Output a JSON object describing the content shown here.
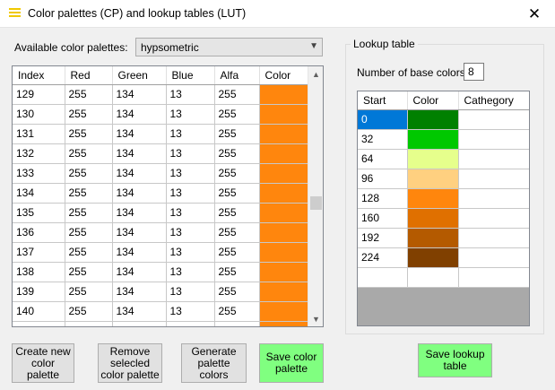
{
  "window": {
    "title": "Color palettes (CP) and lookup tables (LUT)",
    "close_glyph": "✕"
  },
  "palette_selector": {
    "label": "Available color palettes:",
    "value": "hypsometric"
  },
  "palette_table": {
    "columns": [
      "Index",
      "Red",
      "Green",
      "Blue",
      "Alfa",
      "Color"
    ],
    "rows": [
      {
        "index": "129",
        "red": "255",
        "green": "134",
        "blue": "13",
        "alfa": "255",
        "color": "#ff860d"
      },
      {
        "index": "130",
        "red": "255",
        "green": "134",
        "blue": "13",
        "alfa": "255",
        "color": "#ff860d"
      },
      {
        "index": "131",
        "red": "255",
        "green": "134",
        "blue": "13",
        "alfa": "255",
        "color": "#ff860d"
      },
      {
        "index": "132",
        "red": "255",
        "green": "134",
        "blue": "13",
        "alfa": "255",
        "color": "#ff860d"
      },
      {
        "index": "133",
        "red": "255",
        "green": "134",
        "blue": "13",
        "alfa": "255",
        "color": "#ff860d"
      },
      {
        "index": "134",
        "red": "255",
        "green": "134",
        "blue": "13",
        "alfa": "255",
        "color": "#ff860d"
      },
      {
        "index": "135",
        "red": "255",
        "green": "134",
        "blue": "13",
        "alfa": "255",
        "color": "#ff860d"
      },
      {
        "index": "136",
        "red": "255",
        "green": "134",
        "blue": "13",
        "alfa": "255",
        "color": "#ff860d"
      },
      {
        "index": "137",
        "red": "255",
        "green": "134",
        "blue": "13",
        "alfa": "255",
        "color": "#ff860d"
      },
      {
        "index": "138",
        "red": "255",
        "green": "134",
        "blue": "13",
        "alfa": "255",
        "color": "#ff860d"
      },
      {
        "index": "139",
        "red": "255",
        "green": "134",
        "blue": "13",
        "alfa": "255",
        "color": "#ff860d"
      },
      {
        "index": "140",
        "red": "255",
        "green": "134",
        "blue": "13",
        "alfa": "255",
        "color": "#ff860d"
      },
      {
        "index": "",
        "red": "",
        "green": "",
        "blue": "",
        "alfa": "",
        "color": "#ff860d"
      }
    ]
  },
  "lookup_table": {
    "group_title": "Lookup table",
    "base_colors_label": "Number of base colors:",
    "base_colors_value": "8",
    "columns": [
      "Start",
      "Color",
      "Cathegory"
    ],
    "rows": [
      {
        "start": "0",
        "color": "#008000",
        "category": ""
      },
      {
        "start": "32",
        "color": "#00c800",
        "category": ""
      },
      {
        "start": "64",
        "color": "#e6ff8c",
        "category": ""
      },
      {
        "start": "96",
        "color": "#ffd080",
        "category": ""
      },
      {
        "start": "128",
        "color": "#ff860d",
        "category": ""
      },
      {
        "start": "160",
        "color": "#e07000",
        "category": ""
      },
      {
        "start": "192",
        "color": "#b45a00",
        "category": ""
      },
      {
        "start": "224",
        "color": "#804000",
        "category": ""
      },
      {
        "start": "",
        "color": "",
        "category": ""
      }
    ]
  },
  "buttons": {
    "create": "Create new color palette",
    "remove": "Remove selecled color palette",
    "generate": "Generate palette colors",
    "save_palette": "Save color palette",
    "save_lookup": "Save lookup table"
  },
  "colors": {
    "selection": "#0078d7",
    "save_button": "#80ff80"
  }
}
